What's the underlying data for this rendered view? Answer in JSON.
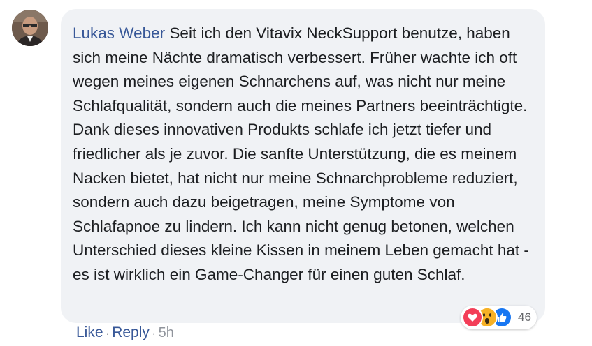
{
  "comment": {
    "author": "Lukas Weber",
    "text": "Seit ich den Vitavix NeckSupport benutze, haben sich meine Nächte dramatisch verbessert. Früher wachte ich oft wegen meines eigenen Schnarchens auf, was nicht nur meine Schlafqualität, sondern auch die meines Partners beeinträchtigte. Dank dieses innovativen Produkts schlafe ich jetzt tiefer und friedlicher als je zuvor. Die sanfte Unterstützung, die es meinem Nacken bietet, hat nicht nur meine Schnarchprobleme reduziert, sondern auch dazu beigetragen, meine Symptome von Schlafapnoe zu lindern. Ich kann nicht genug betonen, welchen Unterschied dieses kleine Kissen in meinem Leben gemacht hat - es ist wirklich ein Game-Changer für einen guten Schlaf.",
    "reactions": {
      "icons": [
        "love-icon",
        "wow-icon",
        "like-icon"
      ],
      "count": "46"
    },
    "actions": {
      "like_label": "Like",
      "reply_label": "Reply",
      "separator": "·",
      "time": "5h"
    }
  },
  "colors": {
    "author_link": "#385898",
    "bubble_bg": "#f0f2f5",
    "love": "#f33e58",
    "wow": "#f7b125",
    "like": "#1877f2"
  }
}
